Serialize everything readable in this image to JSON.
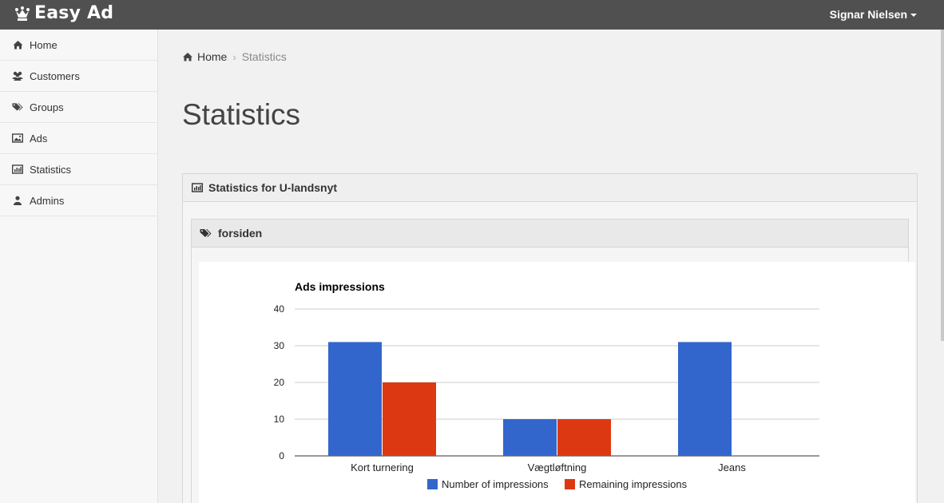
{
  "app": {
    "brand": "Easy Ad",
    "brand_icon": "queen-chess-icon"
  },
  "user": {
    "name": "Signar Nielsen"
  },
  "sidebar": {
    "items": [
      {
        "label": "Home",
        "icon": "home-icon"
      },
      {
        "label": "Customers",
        "icon": "users-icon"
      },
      {
        "label": "Groups",
        "icon": "tags-icon"
      },
      {
        "label": "Ads",
        "icon": "picture-icon"
      },
      {
        "label": "Statistics",
        "icon": "bar-chart-icon"
      },
      {
        "label": "Admins",
        "icon": "user-icon"
      }
    ]
  },
  "breadcrumb": {
    "home": "Home",
    "separator": "›",
    "current": "Statistics"
  },
  "page": {
    "title": "Statistics"
  },
  "panel": {
    "title": "Statistics for U-landsnyt"
  },
  "subpanel": {
    "title": "forsiden"
  },
  "colors": {
    "topbar": "#505050",
    "series_blue": "#3366cc",
    "series_red": "#dc3912"
  },
  "chart_data": {
    "type": "bar",
    "title": "Ads impressions",
    "categories": [
      "Kort turnering",
      "Vægtløftning",
      "Jeans"
    ],
    "series": [
      {
        "name": "Number of impressions",
        "values": [
          31,
          10,
          31
        ],
        "color": "#3366cc"
      },
      {
        "name": "Remaining impressions",
        "values": [
          20,
          10,
          0
        ],
        "color": "#dc3912"
      }
    ],
    "ylim": [
      0,
      40
    ],
    "yticks": [
      0,
      10,
      20,
      30,
      40
    ],
    "grid": true,
    "legend": "bottom"
  }
}
